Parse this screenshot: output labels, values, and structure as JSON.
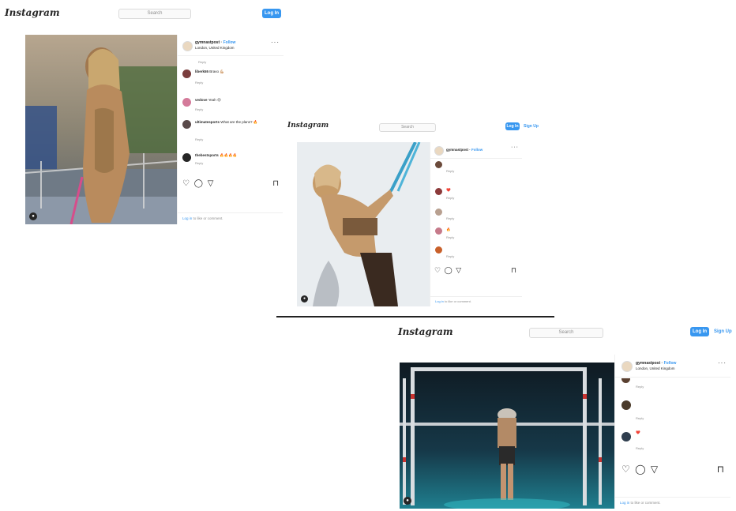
{
  "brand": "Instagram",
  "search_placeholder": "Search",
  "login_label": "Log In",
  "signup_label": "Sign Up",
  "follow_label": "Follow",
  "reply_label": "Reply",
  "login_prompt": "to like or comment.",
  "login_link": "Log in",
  "icons": {
    "heart": "heart-icon",
    "comment": "comment-icon",
    "share": "share-icon",
    "bookmark": "bookmark-icon",
    "more": "more-icon"
  },
  "colors": {
    "accent": "#3897f0",
    "text": "#262626",
    "muted": "#8e8e8e",
    "border": "#dbdbdb"
  },
  "posts": [
    {
      "account": "gymnastpost",
      "location": "London, United Kingdom",
      "comments": [
        {
          "user": "",
          "text": "",
          "meta": "Reply"
        },
        {
          "user": "liberk55",
          "text": "Bravo 💪🏼",
          "meta": "Reply"
        },
        {
          "user": "vedove",
          "text": "Yeah 😍",
          "meta": "Reply"
        },
        {
          "user": "ultimatesports",
          "text": "What are the plans? 🔥",
          "meta": "Reply"
        },
        {
          "user": "thebestsports",
          "text": "🔥🔥🔥🔥",
          "meta": "Reply"
        }
      ],
      "likes": "",
      "date": ""
    },
    {
      "account": "gymnastpost",
      "location": "",
      "comments": [
        {
          "user": "",
          "text": "",
          "meta": "Reply"
        },
        {
          "user": "",
          "text": "❤️",
          "meta": "Reply"
        },
        {
          "user": "",
          "text": "",
          "meta": "Reply"
        },
        {
          "user": "",
          "text": "🔥",
          "meta": "Reply"
        },
        {
          "user": "",
          "text": "",
          "meta": "Reply"
        }
      ],
      "likes": "",
      "date": ""
    },
    {
      "account": "gymnastpost",
      "location": "London, United Kingdom",
      "comments": [
        {
          "user": "",
          "text": "",
          "meta": "Reply"
        },
        {
          "user": "",
          "text": "",
          "meta": "Reply"
        },
        {
          "user": "",
          "text": "❤️",
          "meta": "Reply"
        }
      ],
      "likes": "",
      "date": ""
    }
  ]
}
